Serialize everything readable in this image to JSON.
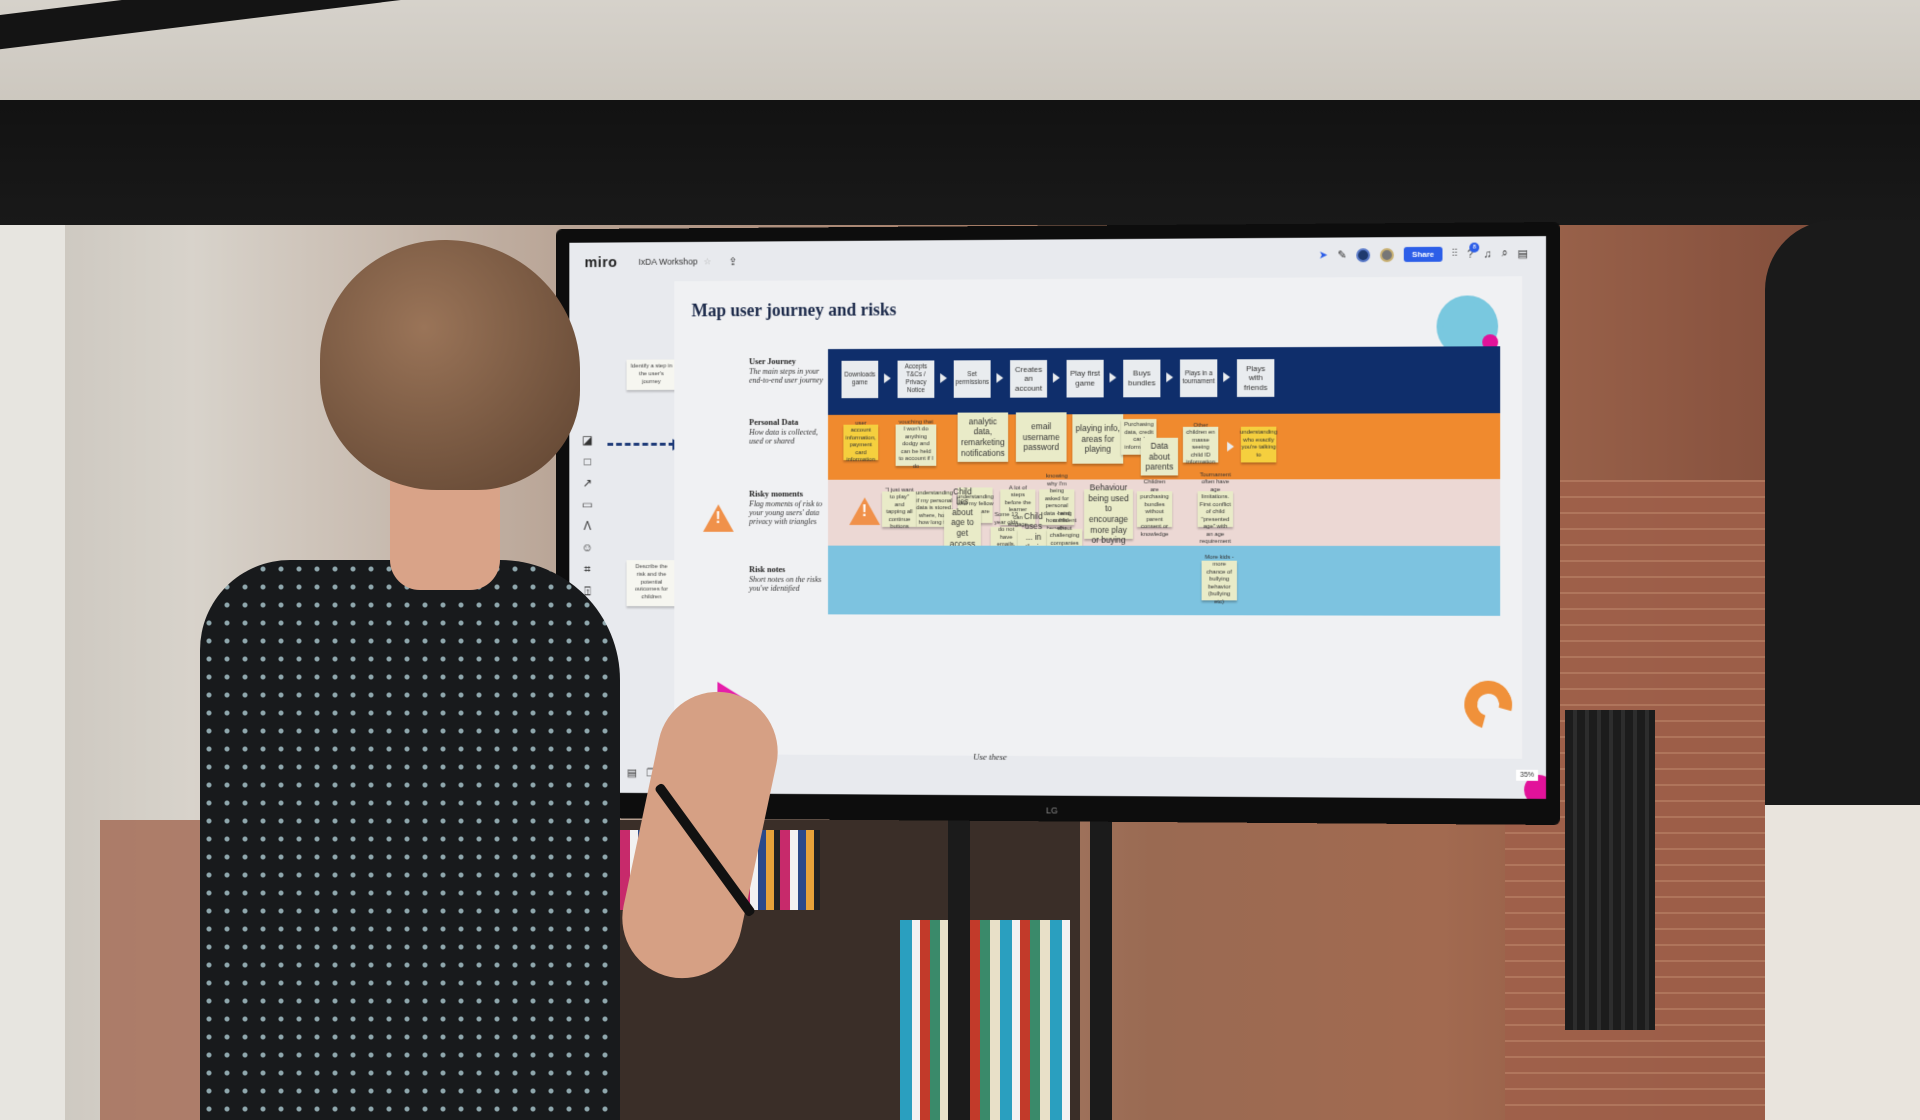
{
  "app": {
    "brand": "miro",
    "board_title": "IxDA Workshop",
    "share_label": "Share",
    "notification_count": "8",
    "zoom_level": "35%",
    "monitor_brand": "LG"
  },
  "frame": {
    "title": "Map user journey and risks",
    "instruction_notes": [
      "Identify a step in the user's journey",
      "Describe the risk and the potential outcomes for children"
    ],
    "footer_text": "Use these"
  },
  "lanes": [
    {
      "title": "User Journey",
      "subtitle": "The main steps in your end-to-end user journey"
    },
    {
      "title": "Personal Data",
      "subtitle": "How data is collected, used or shared"
    },
    {
      "title": "Risky moments",
      "subtitle": "Flag moments of risk to your young users' data privacy with triangles"
    },
    {
      "title": "Risk notes",
      "subtitle": "Short notes on the risks you've identified"
    }
  ],
  "journey_steps": [
    "Downloads game",
    "Accepts T&Cs / Privacy Notice",
    "Set permissions",
    "Creates an account",
    "Play first game",
    "Buys bundles",
    "Plays in a tournament",
    "Plays with friends"
  ],
  "personal_data_notes": [
    "user account information, payment card information",
    "vouching that I won't do anything dodgy and can be held to account if I do",
    "analytic data, remarketing notifications",
    "email username password",
    "playing info, areas for playing",
    "Purchasing data, credit card information",
    "Data about parents",
    "Other children en masse seeing child ID information",
    "understanding who exactly you're talking to"
  ],
  "risky_moment_notes": [
    "\"I just want to play\" and tapping all continue buttons",
    "understanding if my personal data is stored, where, how, how long for",
    "understanding who my fellow players are",
    "Child lies about age to get access to system",
    "A lot of steps before the learner can engage",
    "knowing why I'm being asked for personal data - and how this benefits me",
    "Some 13 year olds do not have emails, use parent accounts",
    "Child uses ... in their public facing ID",
    "being confident about challenging companies that request info which doesn't benefit me",
    "Behaviour being used to encourage more play or buying",
    "Children are purchasing bundles without parent consent or knowledge",
    "Tournament often have age limitations. First conflict of child \"presented age\" with an age requirement"
  ],
  "risk_notes": [
    "More kids - more chance of bullying behavior (bullying etc)"
  ],
  "toolbar": {
    "left_tools": [
      "sticky-note",
      "shape",
      "connector",
      "comment",
      "pen",
      "emoji",
      "frame",
      "upload"
    ],
    "bottom_tools": [
      "present",
      "comments",
      "cards",
      "templates",
      "reactions",
      "video",
      "timer",
      "lightning"
    ]
  },
  "colors": {
    "journey_lane": "#0f2e6b",
    "data_lane": "#f08a2e",
    "risk_lane": "#ecd8d4",
    "notes_lane": "#7dc3e0",
    "sticky": "#e9ebc8",
    "sticky_yellow": "#f5cf3e",
    "share_button": "#2c5ee8"
  }
}
